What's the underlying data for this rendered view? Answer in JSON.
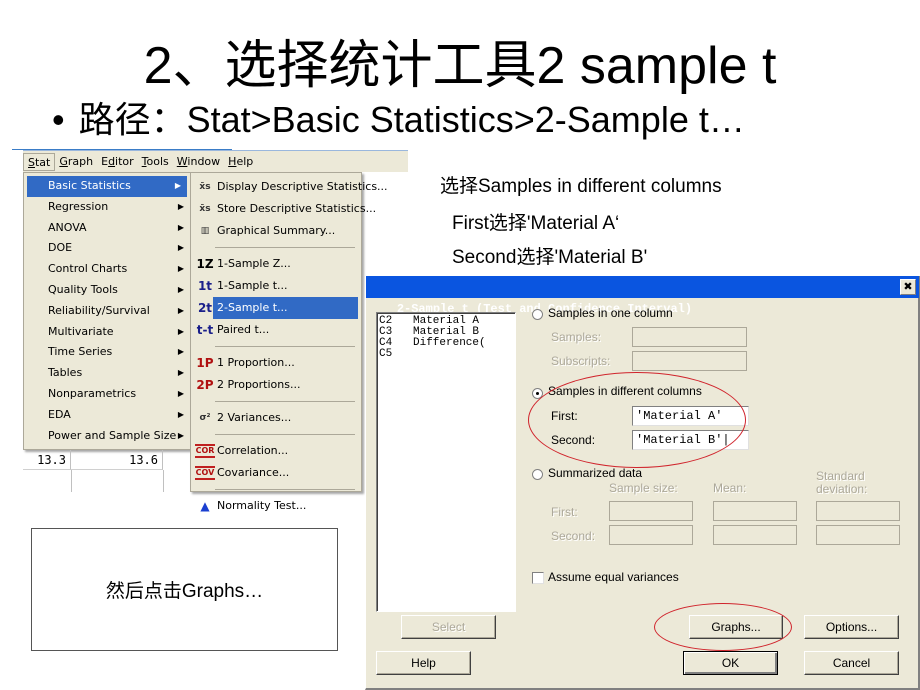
{
  "slide": {
    "title": "2、选择统计工具2 sample t",
    "bullet_char": "•",
    "bullet_text": "路径：Stat>Basic Statistics>2-Sample t…",
    "notes": [
      "选择Samples in different columns",
      "First选择'Material A‘",
      "Second选择'Material B'"
    ],
    "callout": "然后点击Graphs…"
  },
  "menubar": {
    "items": [
      {
        "label": "Stat",
        "underline": "S",
        "active": true
      },
      {
        "label": "Graph",
        "underline": "G"
      },
      {
        "label": "Editor",
        "underline": "d"
      },
      {
        "label": "Tools",
        "underline": "T"
      },
      {
        "label": "Window",
        "underline": "W"
      },
      {
        "label": "Help",
        "underline": "H"
      }
    ]
  },
  "stat_menu": {
    "items": [
      {
        "label": "Basic Statistics",
        "highlighted": true
      },
      {
        "label": "Regression"
      },
      {
        "label": "ANOVA"
      },
      {
        "label": "DOE"
      },
      {
        "label": "Control Charts"
      },
      {
        "label": "Quality Tools"
      },
      {
        "label": "Reliability/Survival"
      },
      {
        "label": "Multivariate"
      },
      {
        "label": "Time Series"
      },
      {
        "label": "Tables"
      },
      {
        "label": "Nonparametrics"
      },
      {
        "label": "EDA"
      },
      {
        "label": "Power and Sample Size"
      }
    ],
    "arrow": "▶"
  },
  "basic_stats_menu": {
    "items": [
      {
        "icon": "x̄s",
        "icon_name": "descriptive-stats-icon",
        "label": "Display Descriptive Statistics..."
      },
      {
        "icon": "x̄s",
        "icon_name": "store-stats-icon",
        "label": "Store Descriptive Statistics..."
      },
      {
        "icon": "▥",
        "icon_name": "graphical-summary-icon",
        "label": "Graphical Summary..."
      },
      {
        "icon": "1Z",
        "icon_name": "one-sample-z-icon",
        "label": "1-Sample Z..."
      },
      {
        "icon": "1t",
        "icon_name": "one-sample-t-icon",
        "label": "1-Sample t..."
      },
      {
        "icon": "2t",
        "icon_name": "two-sample-t-icon",
        "label": "2-Sample t...",
        "highlighted": true
      },
      {
        "icon": "t-t",
        "icon_name": "paired-t-icon",
        "label": "Paired t..."
      },
      {
        "icon": "1P",
        "icon_name": "one-proportion-icon",
        "label": "1 Proportion..."
      },
      {
        "icon": "2P",
        "icon_name": "two-proportions-icon",
        "label": "2 Proportions..."
      },
      {
        "icon": "σ²",
        "icon_name": "two-variances-icon",
        "label": "2 Variances..."
      },
      {
        "icon": "COR",
        "icon_name": "correlation-icon",
        "label": "Correlation..."
      },
      {
        "icon": "COV",
        "icon_name": "covariance-icon",
        "label": "Covariance..."
      },
      {
        "icon": "▲",
        "icon_name": "normality-test-icon",
        "label": "Normality Test..."
      }
    ]
  },
  "worksheet": {
    "row_values": [
      "13.3",
      "13.6"
    ]
  },
  "dialog": {
    "title": "2-Sample t (Test and Confidence Interval)",
    "close_glyph": "✖",
    "columns": [
      {
        "id": "C2",
        "name": "Material A"
      },
      {
        "id": "C3",
        "name": "Material B"
      },
      {
        "id": "C4",
        "name": "Difference("
      },
      {
        "id": "C5",
        "name": ""
      }
    ],
    "one_column": {
      "label": "Samples in one column",
      "selected": false,
      "samples_label": "Samples:",
      "subscripts_label": "Subscripts:"
    },
    "different_columns": {
      "label": "Samples in different columns",
      "selected": true,
      "first_label": "First:",
      "first_value": "'Material A'",
      "second_label": "Second:",
      "second_value": "'Material B'|"
    },
    "summarized": {
      "label": "Summarized data",
      "selected": false,
      "col_sample_size": "Sample size:",
      "col_mean": "Mean:",
      "col_std_line1": "Standard",
      "col_std_line2": "deviation:",
      "first_label": "First:",
      "second_label": "Second:"
    },
    "assume_equal_variances": {
      "label": "Assume equal variances",
      "checked": false
    },
    "buttons": {
      "select": "Select",
      "help": "Help",
      "graphs": "Graphs...",
      "options": "Options...",
      "ok": "OK",
      "cancel": "Cancel"
    }
  },
  "annotation_color": "#d0242c"
}
